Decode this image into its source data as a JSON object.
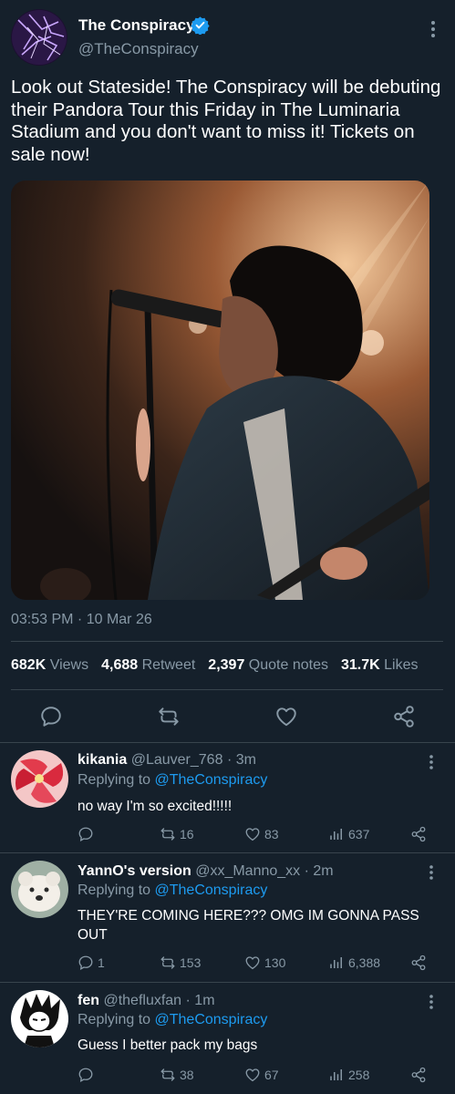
{
  "tweet": {
    "author_name": "The Conspiracy",
    "author_handle": "@TheConspiracy",
    "text": "Look out Stateside! The Conspiracy will be debuting their Pandora Tour this Friday in The Luminaria Stadium and you don't want to miss it! Tickets on sale now!",
    "timestamp": "03:53 PM · 10 Mar 26",
    "stats": {
      "views_count": "682K",
      "views_label": "Views",
      "retweets_count": "4,688",
      "retweets_label": "Retweet",
      "quotes_count": "2,397",
      "quotes_label": "Quote notes",
      "likes_count": "31.7K",
      "likes_label": "Likes"
    }
  },
  "replies": [
    {
      "name": "kikania",
      "handle": "@Lauver_768",
      "time": "· 3m",
      "replying_label": "Replying to",
      "replying_to": "@TheConspiracy",
      "text": "no way I'm so excited!!!!!",
      "replies": "",
      "retweets": "16",
      "likes": "83",
      "views": "637"
    },
    {
      "name": "YannO's version",
      "handle": "@xx_Manno_xx",
      "time": "· 2m",
      "replying_label": "Replying to",
      "replying_to": "@TheConspiracy",
      "text": "THEY'RE COMING HERE??? OMG IM GONNA PASS OUT",
      "replies": "1",
      "retweets": "153",
      "likes": "130",
      "views": "6,388"
    },
    {
      "name": "fen",
      "handle": "@thefluxfan",
      "time": "· 1m",
      "replying_label": "Replying to",
      "replying_to": "@TheConspiracy",
      "text": "Guess I better pack my bags",
      "replies": "",
      "retweets": "38",
      "likes": "67",
      "views": "258"
    }
  ],
  "icons": {
    "verified": "verified-badge-icon",
    "reply": "reply-icon",
    "retweet": "retweet-icon",
    "like": "heart-icon",
    "share": "share-icon",
    "views": "views-icon",
    "more": "more-icon"
  },
  "colors": {
    "background": "#15202b",
    "accent": "#1d9bf0",
    "muted": "#8899a6",
    "divider": "#38444d"
  }
}
